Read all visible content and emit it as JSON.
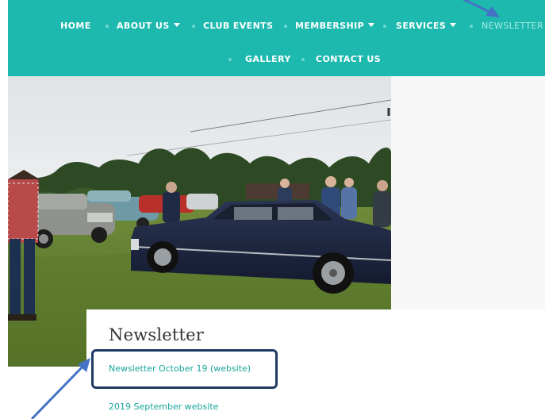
{
  "nav": {
    "row1": [
      {
        "label": "HOME"
      },
      {
        "label": "ABOUT US"
      },
      {
        "label": "CLUB EVENTS"
      },
      {
        "label": "MEMBERSHIP"
      },
      {
        "label": "SERVICES"
      },
      {
        "label": "NEWSLETTER"
      }
    ],
    "row2": [
      {
        "label": "GALLERY"
      },
      {
        "label": "CONTACT US"
      }
    ],
    "active_item": "NEWSLETTER"
  },
  "content": {
    "title": "Newsletter",
    "links": [
      {
        "label": "Newsletter October 19 (website)"
      },
      {
        "label": "2019 September website"
      }
    ]
  },
  "colors": {
    "nav_background": "#1db9ae",
    "link": "#1aa59a",
    "annotation": "#1f3a64",
    "arrow": "#4472c4"
  },
  "icons": {
    "dropdown": "caret-down-icon",
    "annotation_arrows": "arrow-icon"
  }
}
